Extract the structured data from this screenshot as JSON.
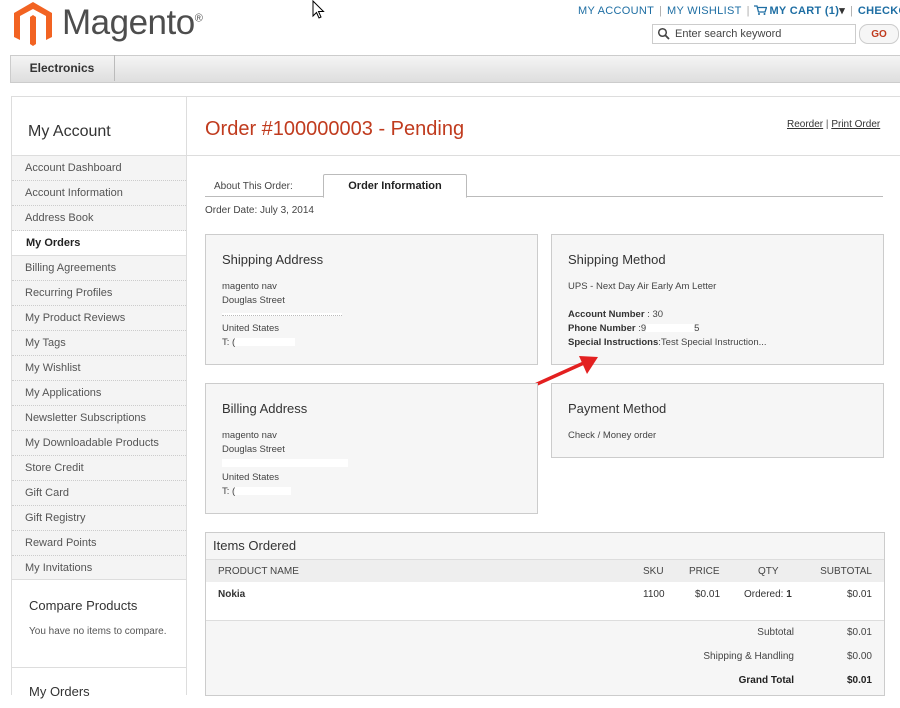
{
  "header": {
    "logo_text": "Magento",
    "logo_reg": "®",
    "links": {
      "account": "MY ACCOUNT",
      "wishlist": "MY WISHLIST",
      "cart": "MY CART (1)",
      "cart_arrow": "▾",
      "checkout": "CHECKOUT",
      "sep": "|"
    },
    "search_placeholder": "Enter search keyword",
    "go_label": "GO"
  },
  "nav": {
    "electronics": "Electronics"
  },
  "sidebar": {
    "title": "My Account",
    "items": [
      "Account Dashboard",
      "Account Information",
      "Address Book",
      "My Orders",
      "Billing Agreements",
      "Recurring Profiles",
      "My Product Reviews",
      "My Tags",
      "My Wishlist",
      "My Applications",
      "Newsletter Subscriptions",
      "My Downloadable Products",
      "Store Credit",
      "Gift Card",
      "Gift Registry",
      "Reward Points",
      "My Invitations"
    ],
    "compare_title": "Compare Products",
    "compare_text": "You have no items to compare.",
    "myorders_title": "My Orders"
  },
  "order": {
    "title": "Order #100000003 - Pending",
    "reorder": "Reorder",
    "link_sep": "|",
    "print": "Print Order",
    "tab_about": "About This Order:",
    "tab_info": "Order Information",
    "order_date": "Order Date: July 3, 2014"
  },
  "shipping_address": {
    "title": "Shipping Address",
    "name": "magento nav",
    "street": "Douglas Street",
    "country": "United States",
    "phone": "T: ("
  },
  "shipping_method": {
    "title": "Shipping Method",
    "method": "UPS - Next Day Air Early Am Letter",
    "account_label": "Account Number",
    "account_value": " : 30",
    "phone_label": "Phone Number",
    "phone_value": " :9",
    "phone_tail": "5",
    "special_label": "Special Instructions",
    "special_value": ":Test Special Instruction..."
  },
  "billing_address": {
    "title": "Billing Address",
    "name": "magento nav",
    "street": "Douglas Street",
    "country": "United States",
    "phone": "T: ("
  },
  "payment_method": {
    "title": "Payment Method",
    "method": "Check / Money order"
  },
  "items": {
    "title": "Items Ordered",
    "headers": {
      "name": "PRODUCT NAME",
      "sku": "SKU",
      "price": "PRICE",
      "qty": "QTY",
      "subtotal": "SUBTOTAL"
    },
    "rows": [
      {
        "name": "Nokia",
        "sku": "1100",
        "price": "$0.01",
        "qty_label": "Ordered:",
        "qty": "1",
        "subtotal": "$0.01"
      }
    ],
    "totals": {
      "subtotal_label": "Subtotal",
      "subtotal": "$0.01",
      "shipping_label": "Shipping & Handling",
      "shipping": "$0.00",
      "grand_label": "Grand Total",
      "grand": "$0.01"
    }
  },
  "colors": {
    "accent": "#c03b1e",
    "link": "#1e6ea3",
    "logo_orange": "#f26322",
    "arrow": "#e32020"
  }
}
